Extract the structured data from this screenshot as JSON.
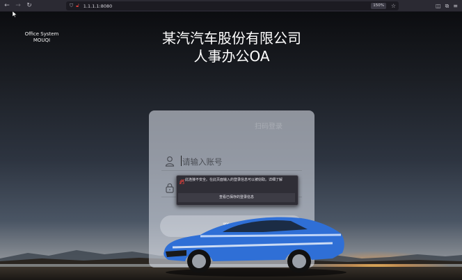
{
  "browser": {
    "url": "1.1.1.1:8080",
    "zoom": "150%"
  },
  "page": {
    "brand_line1": "Office System",
    "brand_line2": "MOUQI",
    "title_line1": "某汽汽车股份有限公司",
    "title_line2": "人事办公OA"
  },
  "login": {
    "tab1": "",
    "tab2": "扫码登录",
    "account_placeholder": "请输入账号",
    "password_placeholder": "",
    "login_label": "登录"
  },
  "warning": {
    "message": "此连接不安全。在此页面输入的登录信息可以被窃取。详细了解",
    "view_saved": "查看已保存的登录信息"
  },
  "colors": {
    "insecure_lock": "#e0403b",
    "car_blue": "#2f6fd6"
  }
}
